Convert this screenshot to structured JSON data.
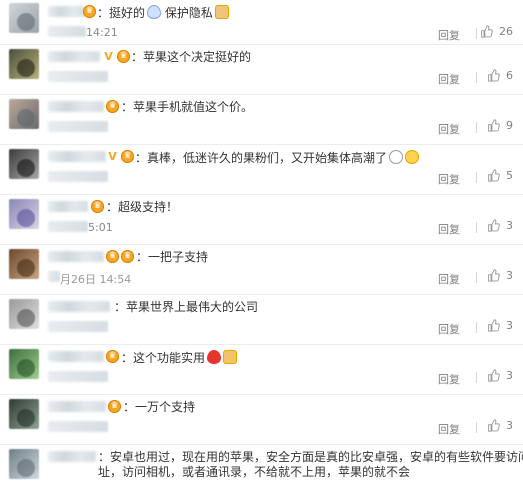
{
  "comments": [
    {
      "time": "14:21",
      "text": "：挺好的",
      "text2": "保护隐私",
      "reply": "回复",
      "likes": "26"
    },
    {
      "time": "",
      "text": "：苹果这个决定挺好的",
      "reply": "回复",
      "likes": "6"
    },
    {
      "time": "",
      "text": "：苹果手机就值这个价。",
      "reply": "回复",
      "likes": "9"
    },
    {
      "time": "",
      "text": "：真棒，低迷许久的果粉们，又开始集体高潮了",
      "reply": "回复",
      "likes": "5"
    },
    {
      "time": "5:01",
      "text": "：超级支持！",
      "reply": "回复",
      "likes": "3"
    },
    {
      "time": "月26日 14:54",
      "text": "：一把子支持",
      "reply": "回复",
      "likes": "3"
    },
    {
      "time": "",
      "text": "：苹果世界上最伟大的公司",
      "reply": "回复",
      "likes": "3"
    },
    {
      "time": "",
      "text": "：这个功能实用",
      "reply": "回复",
      "likes": "3"
    },
    {
      "time": "",
      "text": "：一万个支持",
      "reply": "回复",
      "likes": "3"
    },
    {
      "text": "：安卓也用过，现在用的苹果，安全方面是真的比安卓强，安卓的有些软件要访问地址，访问相机，或者通讯录，不给就不上用，苹果的就不会"
    }
  ],
  "icons": {
    "like": "thumbs-up-icon",
    "member": "vip-badge-icon"
  },
  "colors": {
    "badge": "#f5a623",
    "meta_text": "#808080",
    "divider": "#ececec"
  }
}
